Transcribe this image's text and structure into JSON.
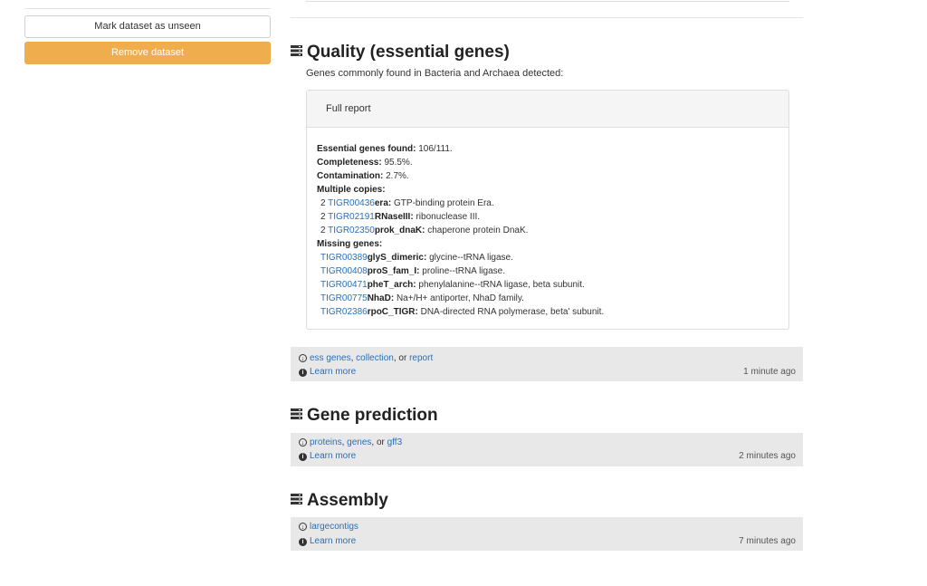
{
  "sidebar": {
    "mark_unseen": "Mark dataset as unseen",
    "remove": "Remove dataset"
  },
  "quality": {
    "title": "Quality (essential genes)",
    "description": "Genes commonly found in Bacteria and Archaea detected:",
    "panel_title": "Full report",
    "essential_label": "Essential genes found:",
    "essential_value": "106/111.",
    "completeness_label": "Completeness:",
    "completeness_value": "95.5%.",
    "contamination_label": "Contamination:",
    "contamination_value": "2.7%.",
    "multiple_label": "Multiple copies:",
    "multiple": [
      {
        "count": "2",
        "id": "TIGR00436",
        "name": "era:",
        "desc": "GTP-binding protein Era."
      },
      {
        "count": "2",
        "id": "TIGR02191",
        "name": "RNaseIII:",
        "desc": "ribonuclease III."
      },
      {
        "count": "2",
        "id": "TIGR02350",
        "name": "prok_dnaK:",
        "desc": "chaperone protein DnaK."
      }
    ],
    "missing_label": "Missing genes:",
    "missing": [
      {
        "id": "TIGR00389",
        "name": "glyS_dimeric:",
        "desc": "glycine--tRNA ligase."
      },
      {
        "id": "TIGR00408",
        "name": "proS_fam_I:",
        "desc": "proline--tRNA ligase."
      },
      {
        "id": "TIGR00471",
        "name": "pheT_arch:",
        "desc": "phenylalanine--tRNA ligase, beta subunit."
      },
      {
        "id": "TIGR00775",
        "name": "NhaD:",
        "desc": "Na+/H+ antiporter, NhaD family."
      },
      {
        "id": "TIGR02386",
        "name": "rpoC_TIGR:",
        "desc": "DNA-directed RNA polymerase, beta' subunit."
      }
    ],
    "footer": {
      "link1": "ess genes",
      "sep1": ",",
      "link2": "collection",
      "sep2": ", or",
      "link3": "report",
      "learn": "Learn more",
      "time": "1 minute ago"
    }
  },
  "gene_prediction": {
    "title": "Gene prediction",
    "footer": {
      "link1": "proteins",
      "sep1": ",",
      "link2": "genes",
      "sep2": ", or",
      "link3": "gff3",
      "learn": "Learn more",
      "time": "2 minutes ago"
    }
  },
  "assembly": {
    "title": "Assembly",
    "footer": {
      "link1": "largecontigs",
      "learn": "Learn more",
      "time": "7 minutes ago"
    }
  },
  "icons": {
    "section": "server-stack-icon",
    "download": "download-icon",
    "info": "info-icon"
  }
}
